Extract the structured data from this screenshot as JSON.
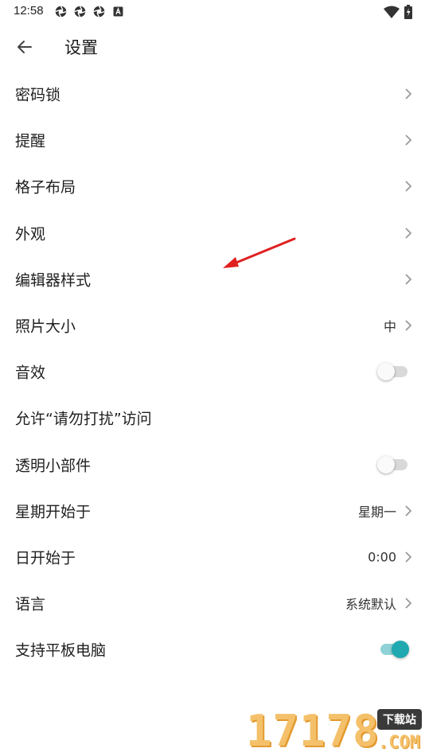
{
  "status_bar": {
    "time": "12:58",
    "icons": [
      "aperture-icon",
      "aperture-icon",
      "aperture-icon",
      "a-box-icon"
    ],
    "right_icons": [
      "wifi-icon",
      "battery-charging-icon"
    ]
  },
  "app_bar": {
    "back_icon": "arrow-left-icon",
    "title": "设置"
  },
  "rows": [
    {
      "label": "密码锁",
      "type": "nav"
    },
    {
      "label": "提醒",
      "type": "nav"
    },
    {
      "label": "格子布局",
      "type": "nav"
    },
    {
      "label": "外观",
      "type": "nav"
    },
    {
      "label": "编辑器样式",
      "type": "nav"
    },
    {
      "label": "照片大小",
      "type": "nav",
      "value": "中"
    },
    {
      "label": "音效",
      "type": "toggle",
      "on": false
    },
    {
      "label": "允许“请勿打扰”访问",
      "type": "plain"
    },
    {
      "label": "透明小部件",
      "type": "toggle",
      "on": false
    },
    {
      "label": "星期开始于",
      "type": "nav",
      "value": "星期一"
    },
    {
      "label": "日开始于",
      "type": "nav",
      "value": "0:00"
    },
    {
      "label": "语言",
      "type": "nav",
      "value": "系统默认"
    },
    {
      "label": "支持平板电脑",
      "type": "toggle",
      "on": true
    }
  ],
  "colors": {
    "accent": "#20a9b0",
    "annotation_arrow": "#e02020"
  },
  "watermark": {
    "digits": "17178",
    "badge": "下载站",
    "domain": ".COM"
  }
}
